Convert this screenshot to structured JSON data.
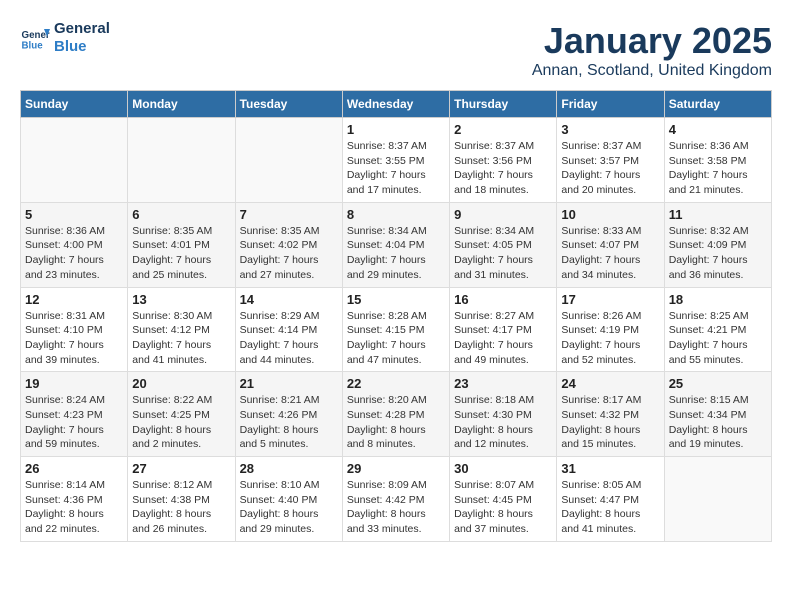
{
  "header": {
    "logo_line1": "General",
    "logo_line2": "Blue",
    "month": "January 2025",
    "location": "Annan, Scotland, United Kingdom"
  },
  "days_of_week": [
    "Sunday",
    "Monday",
    "Tuesday",
    "Wednesday",
    "Thursday",
    "Friday",
    "Saturday"
  ],
  "weeks": [
    [
      {
        "day": "",
        "info": ""
      },
      {
        "day": "",
        "info": ""
      },
      {
        "day": "",
        "info": ""
      },
      {
        "day": "1",
        "info": "Sunrise: 8:37 AM\nSunset: 3:55 PM\nDaylight: 7 hours\nand 17 minutes."
      },
      {
        "day": "2",
        "info": "Sunrise: 8:37 AM\nSunset: 3:56 PM\nDaylight: 7 hours\nand 18 minutes."
      },
      {
        "day": "3",
        "info": "Sunrise: 8:37 AM\nSunset: 3:57 PM\nDaylight: 7 hours\nand 20 minutes."
      },
      {
        "day": "4",
        "info": "Sunrise: 8:36 AM\nSunset: 3:58 PM\nDaylight: 7 hours\nand 21 minutes."
      }
    ],
    [
      {
        "day": "5",
        "info": "Sunrise: 8:36 AM\nSunset: 4:00 PM\nDaylight: 7 hours\nand 23 minutes."
      },
      {
        "day": "6",
        "info": "Sunrise: 8:35 AM\nSunset: 4:01 PM\nDaylight: 7 hours\nand 25 minutes."
      },
      {
        "day": "7",
        "info": "Sunrise: 8:35 AM\nSunset: 4:02 PM\nDaylight: 7 hours\nand 27 minutes."
      },
      {
        "day": "8",
        "info": "Sunrise: 8:34 AM\nSunset: 4:04 PM\nDaylight: 7 hours\nand 29 minutes."
      },
      {
        "day": "9",
        "info": "Sunrise: 8:34 AM\nSunset: 4:05 PM\nDaylight: 7 hours\nand 31 minutes."
      },
      {
        "day": "10",
        "info": "Sunrise: 8:33 AM\nSunset: 4:07 PM\nDaylight: 7 hours\nand 34 minutes."
      },
      {
        "day": "11",
        "info": "Sunrise: 8:32 AM\nSunset: 4:09 PM\nDaylight: 7 hours\nand 36 minutes."
      }
    ],
    [
      {
        "day": "12",
        "info": "Sunrise: 8:31 AM\nSunset: 4:10 PM\nDaylight: 7 hours\nand 39 minutes."
      },
      {
        "day": "13",
        "info": "Sunrise: 8:30 AM\nSunset: 4:12 PM\nDaylight: 7 hours\nand 41 minutes."
      },
      {
        "day": "14",
        "info": "Sunrise: 8:29 AM\nSunset: 4:14 PM\nDaylight: 7 hours\nand 44 minutes."
      },
      {
        "day": "15",
        "info": "Sunrise: 8:28 AM\nSunset: 4:15 PM\nDaylight: 7 hours\nand 47 minutes."
      },
      {
        "day": "16",
        "info": "Sunrise: 8:27 AM\nSunset: 4:17 PM\nDaylight: 7 hours\nand 49 minutes."
      },
      {
        "day": "17",
        "info": "Sunrise: 8:26 AM\nSunset: 4:19 PM\nDaylight: 7 hours\nand 52 minutes."
      },
      {
        "day": "18",
        "info": "Sunrise: 8:25 AM\nSunset: 4:21 PM\nDaylight: 7 hours\nand 55 minutes."
      }
    ],
    [
      {
        "day": "19",
        "info": "Sunrise: 8:24 AM\nSunset: 4:23 PM\nDaylight: 7 hours\nand 59 minutes."
      },
      {
        "day": "20",
        "info": "Sunrise: 8:22 AM\nSunset: 4:25 PM\nDaylight: 8 hours\nand 2 minutes."
      },
      {
        "day": "21",
        "info": "Sunrise: 8:21 AM\nSunset: 4:26 PM\nDaylight: 8 hours\nand 5 minutes."
      },
      {
        "day": "22",
        "info": "Sunrise: 8:20 AM\nSunset: 4:28 PM\nDaylight: 8 hours\nand 8 minutes."
      },
      {
        "day": "23",
        "info": "Sunrise: 8:18 AM\nSunset: 4:30 PM\nDaylight: 8 hours\nand 12 minutes."
      },
      {
        "day": "24",
        "info": "Sunrise: 8:17 AM\nSunset: 4:32 PM\nDaylight: 8 hours\nand 15 minutes."
      },
      {
        "day": "25",
        "info": "Sunrise: 8:15 AM\nSunset: 4:34 PM\nDaylight: 8 hours\nand 19 minutes."
      }
    ],
    [
      {
        "day": "26",
        "info": "Sunrise: 8:14 AM\nSunset: 4:36 PM\nDaylight: 8 hours\nand 22 minutes."
      },
      {
        "day": "27",
        "info": "Sunrise: 8:12 AM\nSunset: 4:38 PM\nDaylight: 8 hours\nand 26 minutes."
      },
      {
        "day": "28",
        "info": "Sunrise: 8:10 AM\nSunset: 4:40 PM\nDaylight: 8 hours\nand 29 minutes."
      },
      {
        "day": "29",
        "info": "Sunrise: 8:09 AM\nSunset: 4:42 PM\nDaylight: 8 hours\nand 33 minutes."
      },
      {
        "day": "30",
        "info": "Sunrise: 8:07 AM\nSunset: 4:45 PM\nDaylight: 8 hours\nand 37 minutes."
      },
      {
        "day": "31",
        "info": "Sunrise: 8:05 AM\nSunset: 4:47 PM\nDaylight: 8 hours\nand 41 minutes."
      },
      {
        "day": "",
        "info": ""
      }
    ]
  ]
}
